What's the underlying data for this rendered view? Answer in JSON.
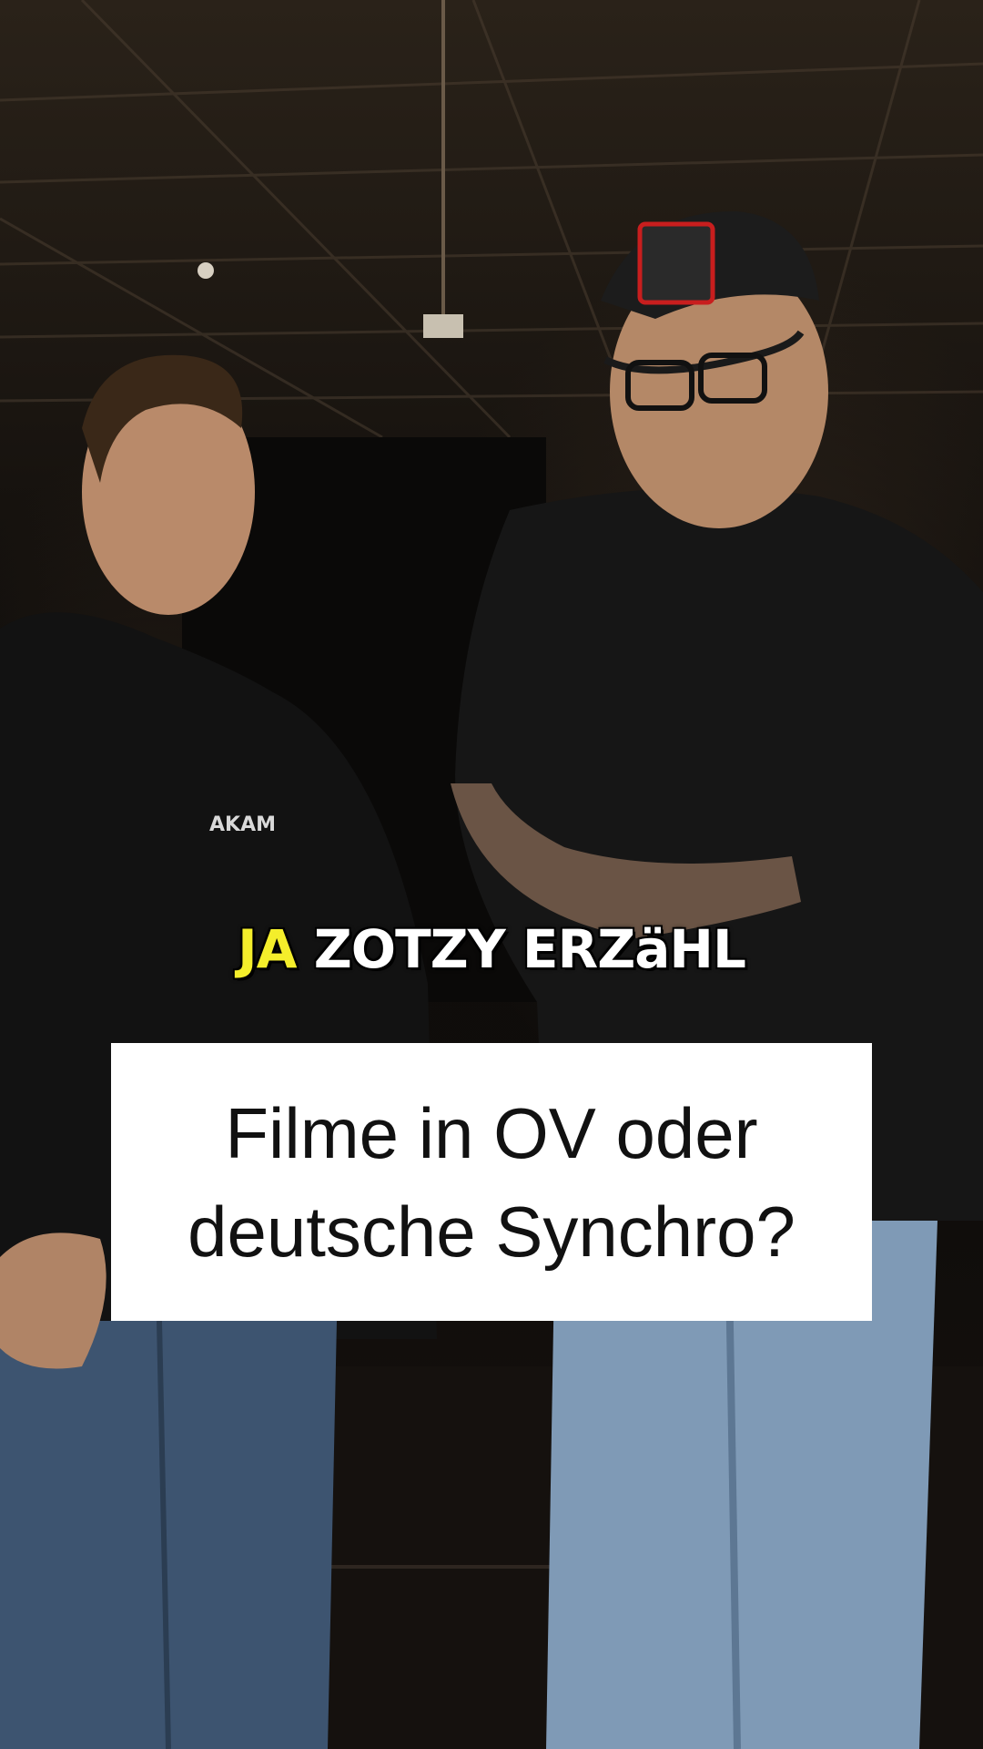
{
  "caption": {
    "highlight_word": "JA",
    "rest": "ZOTZY ERZäHL",
    "highlight_color": "#f4ee2b"
  },
  "question": {
    "text": "Filme in OV oder\ndeutsche Synchro?"
  },
  "clothing_print": {
    "hoodie_logo_text": "AKAM"
  },
  "colors": {
    "background": "#0d0b09",
    "question_box": "#ffffff",
    "caption_text": "#ffffff"
  }
}
